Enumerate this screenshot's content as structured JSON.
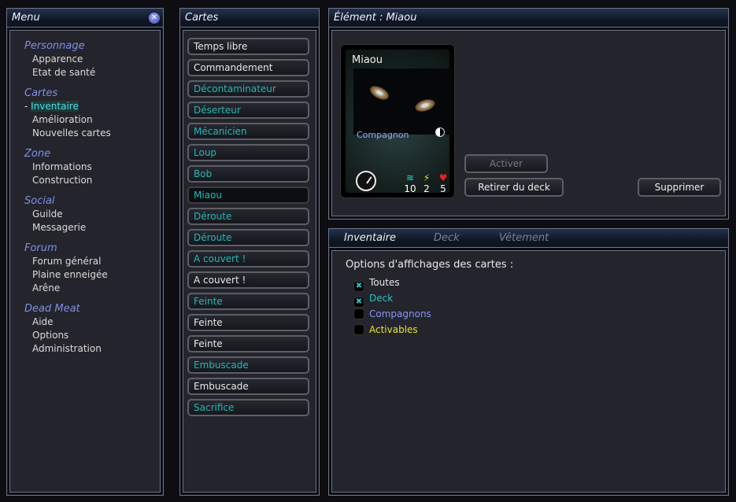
{
  "menu": {
    "title": "Menu",
    "close_icon": "close-icon",
    "groups": [
      {
        "label": "Personnage",
        "items": [
          "Apparence",
          "Etat de santé"
        ]
      },
      {
        "label": "Cartes",
        "items": [
          "- Inventaire",
          "Amélioration",
          "Nouvelles cartes"
        ]
      },
      {
        "label": "Zone",
        "items": [
          "Informations",
          "Construction"
        ]
      },
      {
        "label": "Social",
        "items": [
          "Guilde",
          "Messagerie"
        ]
      },
      {
        "label": "Forum",
        "items": [
          "Forum général",
          "Plaine enneigée",
          "Arêne"
        ]
      },
      {
        "label": "Dead Meat",
        "items": [
          "Aide",
          "Options",
          "Administration"
        ]
      }
    ],
    "active_item": "Inventaire"
  },
  "cards": {
    "title": "Cartes",
    "list": [
      {
        "label": "Temps libre",
        "color": "#e8e8e8"
      },
      {
        "label": "Commandement",
        "color": "#e8e8e8"
      },
      {
        "label": "Décontaminateur",
        "color": "#22b7b7"
      },
      {
        "label": "Déserteur",
        "color": "#22b7b7"
      },
      {
        "label": "Mécanicien",
        "color": "#22b7b7"
      },
      {
        "label": "Loup",
        "color": "#22b7b7"
      },
      {
        "label": "Bob",
        "color": "#22b7b7"
      },
      {
        "label": "Miaou",
        "color": "#22b7b7",
        "selected": true
      },
      {
        "label": "Déroute",
        "color": "#22b7b7"
      },
      {
        "label": "Déroute",
        "color": "#22b7b7"
      },
      {
        "label": "A couvert !",
        "color": "#22b7b7"
      },
      {
        "label": "A couvert !",
        "color": "#e8e8e8"
      },
      {
        "label": "Feinte",
        "color": "#22b7b7"
      },
      {
        "label": "Feinte",
        "color": "#e8e8e8"
      },
      {
        "label": "Feinte",
        "color": "#e8e8e8"
      },
      {
        "label": "Embuscade",
        "color": "#22b7b7"
      },
      {
        "label": "Embuscade",
        "color": "#e8e8e8"
      },
      {
        "label": "Sacrifice",
        "color": "#22b7b7"
      }
    ]
  },
  "element": {
    "title": "Élément : Miaou",
    "card": {
      "name": "Miaou",
      "type": "Compagnon",
      "stats": [
        {
          "icon": "signal-icon",
          "value": "10",
          "color": "#3ad1d1"
        },
        {
          "icon": "lightning-icon",
          "value": "2",
          "color": "#f5d742"
        },
        {
          "icon": "heart-icon",
          "value": "5",
          "color": "#e52222"
        }
      ]
    },
    "buttons": {
      "activate": "Activer",
      "remove_from_deck": "Retirer du deck",
      "delete": "Supprimer"
    }
  },
  "inventory": {
    "tabs": [
      "Inventaire",
      "Deck",
      "Vêtement"
    ],
    "active_tab": "Inventaire",
    "options_title": "Options d'affichages des cartes :",
    "options": [
      {
        "label": "Toutes",
        "checked": true,
        "color": "#e8e8e8"
      },
      {
        "label": "Deck",
        "checked": true,
        "color": "#22c4c4"
      },
      {
        "label": "Compagnons",
        "checked": false,
        "color": "#8a92ff"
      },
      {
        "label": "Activables",
        "checked": false,
        "color": "#e6e62a"
      }
    ]
  }
}
